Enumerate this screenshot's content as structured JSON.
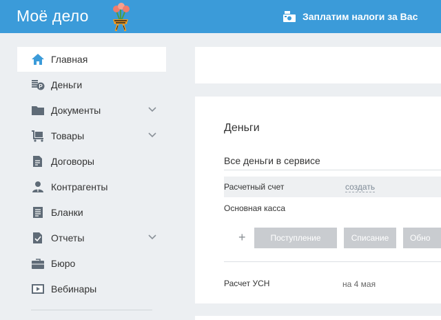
{
  "header": {
    "logo_text": "Moё дело",
    "tax_link": "Заплатим налоги за Вас",
    "tax_icon": "cash-register-icon",
    "background": "#3b9bd9"
  },
  "sidebar": {
    "items": [
      {
        "label": "Главная",
        "icon": "home-icon",
        "active": true,
        "has_chevron": false
      },
      {
        "label": "Деньги",
        "icon": "money-icon",
        "active": false,
        "has_chevron": false
      },
      {
        "label": "Документы",
        "icon": "folder-icon",
        "active": false,
        "has_chevron": true
      },
      {
        "label": "Товары",
        "icon": "cart-icon",
        "active": false,
        "has_chevron": true
      },
      {
        "label": "Договоры",
        "icon": "contract-icon",
        "active": false,
        "has_chevron": false
      },
      {
        "label": "Контрагенты",
        "icon": "person-icon",
        "active": false,
        "has_chevron": false
      },
      {
        "label": "Бланки",
        "icon": "forms-icon",
        "active": false,
        "has_chevron": false
      },
      {
        "label": "Отчеты",
        "icon": "report-check-icon",
        "active": false,
        "has_chevron": true
      },
      {
        "label": "Бюро",
        "icon": "briefcase-icon",
        "active": false,
        "has_chevron": false
      },
      {
        "label": "Вебинары",
        "icon": "video-icon",
        "active": false,
        "has_chevron": false
      }
    ]
  },
  "money_card": {
    "title": "Деньги",
    "all_money": "Все деньги в сервисе",
    "account_name": "Расчетный счет",
    "account_action": "создать",
    "cash_desk": "Основная касса",
    "buttons": [
      "Поступление",
      "Списание",
      "Обно"
    ],
    "usn_label": "Расчет УСН",
    "usn_date": "на 4 мая"
  },
  "colors": {
    "accent": "#3b9bd9",
    "sidebar_icon": "#5f6b77",
    "active_icon": "#3b9bd9",
    "button_bg": "#c9ccd0"
  }
}
